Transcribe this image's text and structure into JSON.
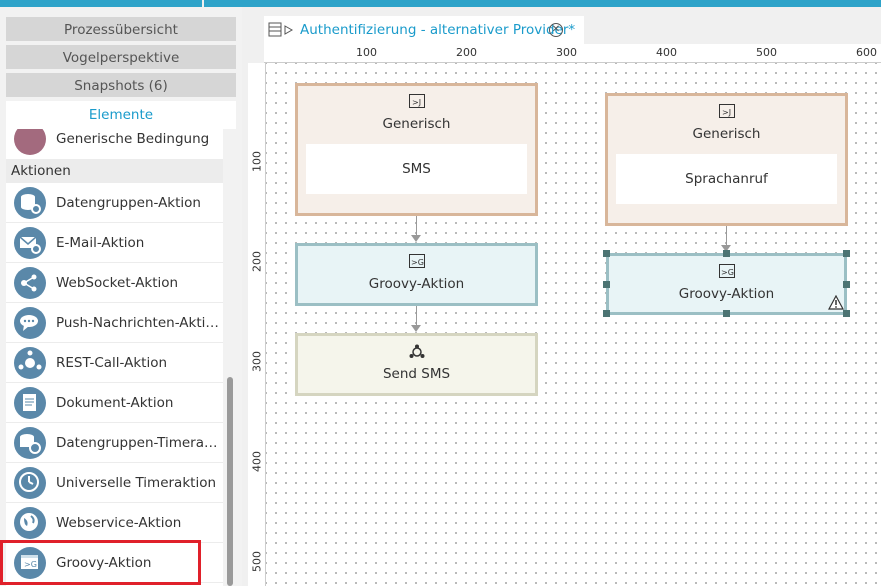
{
  "sidebar": {
    "accordion": [
      "Prozessübersicht",
      "Vogelperspektive",
      "Snapshots (6)",
      "Elemente"
    ],
    "partial_item": "Generische Bedingung",
    "category": "Aktionen",
    "items": [
      {
        "label": "Datengruppen-Aktion",
        "icon": "database-gear-icon"
      },
      {
        "label": "E-Mail-Aktion",
        "icon": "email-gear-icon"
      },
      {
        "label": "WebSocket-Aktion",
        "icon": "websocket-gear-icon"
      },
      {
        "label": "Push-Nachrichten-Aktion",
        "icon": "chat-bubble-gear-icon"
      },
      {
        "label": "REST-Call-Aktion",
        "icon": "network-gear-icon"
      },
      {
        "label": "Dokument-Aktion",
        "icon": "document-gear-icon"
      },
      {
        "label": "Datengruppen-Timeraktion",
        "icon": "database-timer-icon"
      },
      {
        "label": "Universelle Timeraktion",
        "icon": "clock-gear-icon"
      },
      {
        "label": "Webservice-Aktion",
        "icon": "globe-gear-icon"
      },
      {
        "label": "Groovy-Aktion",
        "icon": "groovy-script-icon"
      }
    ]
  },
  "editor": {
    "tab_title": "Authentifizierung - alternativer Provider*",
    "ruler_x": [
      "100",
      "200",
      "300",
      "400",
      "500",
      "600"
    ],
    "ruler_y": [
      "100",
      "200",
      "300",
      "400",
      "500"
    ]
  },
  "nodes": {
    "gen1": {
      "title": "Generisch",
      "body": "SMS"
    },
    "groovy1": {
      "title": "Groovy-Aktion"
    },
    "send": {
      "title": "Send SMS"
    },
    "gen2": {
      "title": "Generisch",
      "body": "Sprachanruf"
    },
    "groovy2": {
      "title": "Groovy-Aktion"
    }
  },
  "colors": {
    "accent": "#1a9bcb",
    "highlight": "#e0202a",
    "icon_bg": "#5a88a9"
  }
}
